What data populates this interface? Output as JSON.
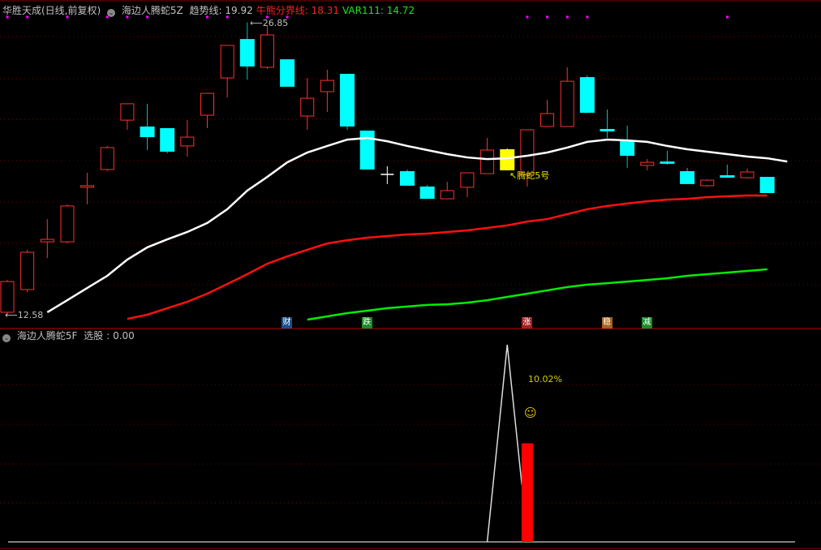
{
  "header": {
    "stock": "华胜天成(日线,前复权)",
    "indicator": "海边人腾蛇5Z",
    "items": [
      {
        "label": "趋势线",
        "value": "19.92",
        "color": "#c0c0c0"
      },
      {
        "label": "牛熊分界线",
        "value": "18.31",
        "color": "#ff2020"
      },
      {
        "label": "VAR111",
        "value": "14.72",
        "color": "#20e020"
      }
    ]
  },
  "sub_header": {
    "indicator": "海边人腾蛇5F",
    "label": "选股",
    "value": "0.00"
  },
  "annotations": {
    "high": "26.85",
    "low": "12.58",
    "marker": "腾蛇5号",
    "percent": "10.02%",
    "smiley": "☺"
  },
  "signals": [
    {
      "text": "财",
      "index": 14,
      "color": "#1d4f8a"
    },
    {
      "text": "跌",
      "index": 18,
      "color": "#1a8a2a"
    },
    {
      "text": "涨",
      "index": 26,
      "color": "#a02020"
    },
    {
      "text": "稳",
      "index": 30,
      "color": "#a8601a"
    },
    {
      "text": "减",
      "index": 32,
      "color": "#1a8a2a"
    }
  ],
  "colors": {
    "up": "#ff3030",
    "down": "#00ffff",
    "marker": "#ffff00",
    "trend": "#ffffff",
    "bull_bear": "#ff1010",
    "var111": "#00ee00",
    "dot": "#ff00ff"
  },
  "chart_data": {
    "type": "candlestick",
    "price_range": [
      12.1,
      27.5
    ],
    "dot_indices": [
      0,
      1,
      3,
      5,
      6,
      7,
      10,
      11,
      13,
      14,
      26,
      27,
      28,
      29,
      36
    ],
    "candles": [
      [
        12.7,
        14.2,
        14.28,
        12.58
      ],
      [
        13.81,
        15.63,
        15.75,
        13.69
      ],
      [
        16.14,
        16.26,
        17.25,
        15.35
      ],
      [
        16.14,
        17.89,
        17.97,
        16.06
      ],
      [
        18.8,
        18.88,
        19.51,
        17.97
      ],
      [
        19.67,
        20.74,
        20.82,
        19.59
      ],
      [
        22.08,
        22.88,
        22.88,
        21.61
      ],
      [
        21.77,
        21.25,
        22.88,
        20.62
      ],
      [
        21.69,
        20.54,
        21.69,
        20.46
      ],
      [
        20.82,
        21.25,
        22.08,
        20.3
      ],
      [
        22.32,
        23.39,
        23.39,
        21.69
      ],
      [
        24.14,
        25.73,
        25.73,
        23.19
      ],
      [
        26.04,
        24.7,
        26.85,
        24.06
      ],
      [
        24.66,
        26.24,
        26.7,
        24.58
      ],
      [
        25.05,
        23.71,
        25.05,
        23.71
      ],
      [
        22.28,
        23.15,
        24.14,
        21.61
      ],
      [
        23.47,
        24.02,
        24.54,
        22.48
      ],
      [
        24.34,
        21.77,
        24.34,
        21.61
      ],
      [
        21.57,
        19.67,
        21.57,
        19.67
      ],
      [
        19.43,
        19.43,
        19.83,
        18.96
      ],
      [
        19.59,
        18.88,
        19.67,
        18.88
      ],
      [
        18.84,
        18.24,
        18.92,
        18.24
      ],
      [
        18.24,
        18.64,
        19.07,
        18.24
      ],
      [
        18.8,
        19.51,
        19.51,
        18.32
      ],
      [
        19.47,
        20.62,
        21.21,
        19.47
      ],
      [
        20.66,
        19.63,
        20.7,
        19.63
      ],
      [
        19.43,
        21.61,
        21.61,
        18.84
      ],
      [
        21.77,
        22.4,
        23.07,
        21.77
      ],
      [
        21.77,
        23.98,
        24.66,
        21.77
      ],
      [
        24.18,
        22.44,
        24.26,
        22.44
      ],
      [
        21.65,
        21.53,
        22.6,
        21.21
      ],
      [
        21.09,
        20.34,
        21.81,
        19.75
      ],
      [
        19.87,
        20.02,
        20.18,
        19.63
      ],
      [
        20.06,
        19.95,
        20.58,
        19.91
      ],
      [
        19.59,
        18.96,
        19.75,
        18.96
      ],
      [
        18.88,
        19.15,
        19.19,
        18.84
      ],
      [
        19.39,
        19.27,
        19.91,
        19.27
      ],
      [
        19.27,
        19.55,
        19.71,
        19.23
      ],
      [
        19.31,
        18.52,
        19.31,
        18.52
      ]
    ],
    "marker_index": 25,
    "series": [
      {
        "name": "趋势线",
        "start": 2,
        "values": [
          12.7,
          13.29,
          13.89,
          14.48,
          15.27,
          15.87,
          16.26,
          16.62,
          17.06,
          17.73,
          18.64,
          19.31,
          20.02,
          20.5,
          20.82,
          21.13,
          21.21,
          21.05,
          20.82,
          20.62,
          20.42,
          20.26,
          20.18,
          20.22,
          20.34,
          20.5,
          20.74,
          21.02,
          21.13,
          21.09,
          21.02,
          20.82,
          20.66,
          20.54,
          20.42,
          20.3,
          20.22,
          20.06
        ]
      },
      {
        "name": "牛熊分界线",
        "start": 6,
        "values": [
          12.38,
          12.58,
          12.9,
          13.21,
          13.61,
          14.08,
          14.56,
          15.07,
          15.43,
          15.75,
          16.06,
          16.22,
          16.34,
          16.42,
          16.5,
          16.54,
          16.62,
          16.7,
          16.82,
          16.94,
          17.13,
          17.25,
          17.49,
          17.73,
          17.89,
          18.01,
          18.12,
          18.2,
          18.24,
          18.32,
          18.36,
          18.4,
          18.4
        ]
      },
      {
        "name": "VAR111",
        "start": 15,
        "values": [
          12.34,
          12.5,
          12.66,
          12.78,
          12.9,
          12.98,
          13.06,
          13.09,
          13.17,
          13.29,
          13.45,
          13.61,
          13.77,
          13.93,
          14.05,
          14.12,
          14.2,
          14.28,
          14.36,
          14.48,
          14.56,
          14.64,
          14.72,
          14.8
        ]
      }
    ],
    "sub": {
      "range": [
        0,
        100
      ],
      "line": [
        0,
        0,
        0,
        0,
        0,
        0,
        0,
        0,
        0,
        0,
        0,
        0,
        0,
        0,
        0,
        0,
        0,
        0,
        0,
        0,
        0,
        0,
        0,
        0,
        0,
        100,
        29,
        0,
        0,
        0,
        0,
        0,
        0,
        0,
        0,
        0,
        0,
        0,
        0
      ],
      "bar_index": 26,
      "bar_value": 50
    }
  }
}
